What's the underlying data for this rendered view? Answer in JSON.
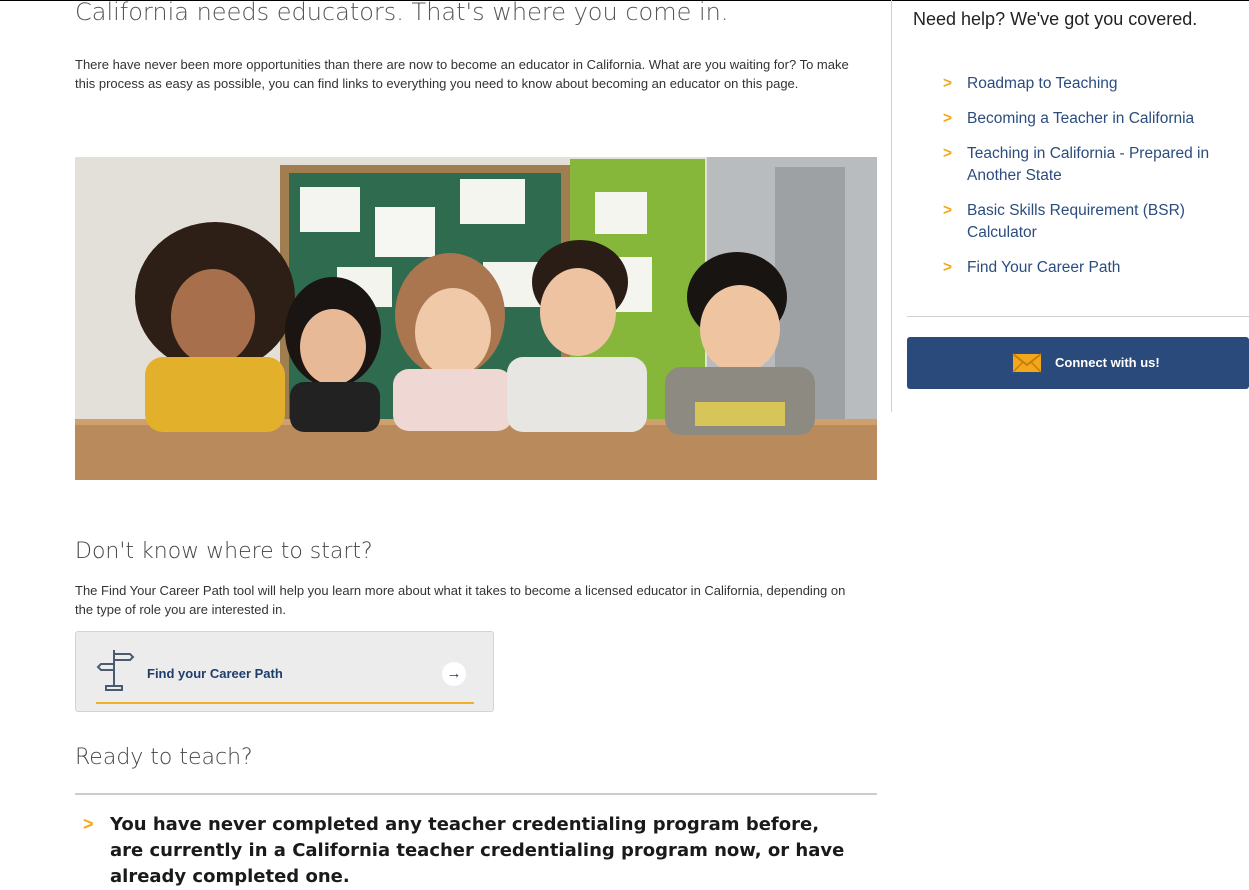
{
  "main": {
    "heading": "California needs educators. That's where you come in.",
    "intro": "There have never been more opportunities than there are now to become an educator in California. What are you waiting for? To make this process as easy as possible, you can find links to everything you need to know about becoming an educator on this page.",
    "career_heading": "Don't know where to start?",
    "career_text": "The Find Your Career Path tool will help you learn more about what it takes to become a licensed educator in California, depending on the type of role you are interested in.",
    "career_button": "Find your Career Path",
    "career_arrow": "→",
    "ready_heading": "Ready to teach?",
    "ready_item": "You have never completed any teacher credentialing program before, are currently in a California teacher credentialing program now, or have already completed one."
  },
  "sidebar": {
    "title": "Need help?  We've got you covered.",
    "chevron": ">",
    "links": [
      "Roadmap to Teaching",
      "Becoming a Teacher in California",
      "Teaching in California - Prepared in Another State",
      "Basic Skills Requirement (BSR) Calculator",
      "Find Your Career Path"
    ],
    "connect_label": "Connect with us!"
  },
  "colors": {
    "navy": "#294a7a",
    "link": "#2b4d7e",
    "accent": "#f3a81c",
    "card_underline": "#f3b02b"
  }
}
